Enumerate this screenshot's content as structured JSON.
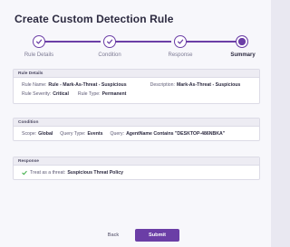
{
  "dialog": {
    "title": "Create Custom Detection Rule"
  },
  "stepper": {
    "steps": [
      {
        "label": "Rule Details",
        "state": "complete"
      },
      {
        "label": "Condition",
        "state": "complete"
      },
      {
        "label": "Response",
        "state": "complete"
      },
      {
        "label": "Summary",
        "state": "current"
      }
    ]
  },
  "rule_details": {
    "header": "Rule Details",
    "rule_name_label": "Rule Name:",
    "rule_name_value": "Rule - Mark-As-Threat - Suspicious",
    "description_label": "Description:",
    "description_value": "Mark-As-Threat - Suspicious",
    "severity_label": "Rule Severity:",
    "severity_value": "Critical",
    "type_label": "Rule Type:",
    "type_value": "Permanent"
  },
  "condition": {
    "header": "Condition",
    "scope_label": "Scope:",
    "scope_value": "Global",
    "query_type_label": "Query Type:",
    "query_type_value": "Events",
    "query_label": "Query:",
    "query_value": "AgentName Contains \"DESKTOP-486NBKA\""
  },
  "response": {
    "header": "Response",
    "action_label": "Treat as a threat:",
    "action_value": "Suspicious Threat Policy"
  },
  "footer": {
    "back_label": "Back",
    "submit_label": "Submit"
  },
  "colors": {
    "accent": "#6b3ea6",
    "success": "#3fae49"
  },
  "icons": {
    "step_complete": "check-icon",
    "response_action": "green-check-icon"
  }
}
